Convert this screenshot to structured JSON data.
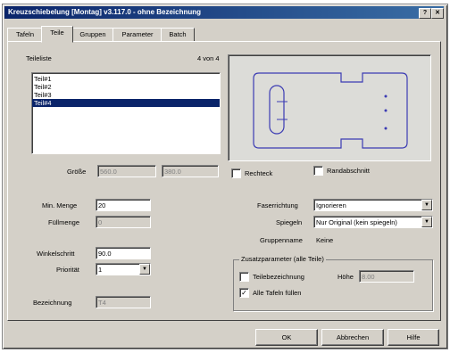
{
  "window": {
    "title": "Kreuzschiebelung [Montag] v3.117.0 - ohne Bezeichnung"
  },
  "tabs": [
    {
      "label": "Tafeln"
    },
    {
      "label": "Teile"
    },
    {
      "label": "Gruppen"
    },
    {
      "label": "Parameter"
    },
    {
      "label": "Batch"
    }
  ],
  "parts": {
    "header": "Teileliste",
    "count": "4 von 4",
    "items": [
      "Teil#1",
      "Teil#2",
      "Teil#3",
      "Teil#4"
    ],
    "selected_index": 3
  },
  "size": {
    "label": "Größe",
    "width": "560.0",
    "height": "380.0"
  },
  "checkboxes": {
    "rechteck": {
      "label": "Rechteck",
      "checked": false
    },
    "randabschnitt": {
      "label": "Randabschnitt",
      "checked": false
    }
  },
  "fields": {
    "min_menge": {
      "label": "Min. Menge",
      "value": "20"
    },
    "fuellmenge": {
      "label": "Füllmenge",
      "value": "0"
    },
    "winkelschritt": {
      "label": "Winkelschritt",
      "value": "90.0"
    },
    "prioritaet": {
      "label": "Priorität",
      "value": "1"
    },
    "bezeichnung": {
      "label": "Bezeichnung",
      "value": "T4"
    }
  },
  "right": {
    "faserrichtung_label": "Faserrichtung",
    "faserrichtung_value": "Ignorieren",
    "spiegeln_label": "Spiegeln",
    "spiegeln_value": "Nur Original (kein spiegeln)",
    "gruppenname_label": "Gruppenname",
    "gruppenname_value": "Keine"
  },
  "zusatz": {
    "title": "Zusatzparameter (alle Teile)",
    "teilebezeichnung": {
      "label": "Teilebezeichnung",
      "checked": false
    },
    "hoehe_label": "Höhe",
    "hoehe_value": "8.00",
    "alle_tafeln": {
      "label": "Alle Tafeln füllen",
      "checked": true
    }
  },
  "buttons": {
    "ok": "OK",
    "abbrechen": "Abbrechen",
    "hilfe": "Hilfe"
  },
  "colors": {
    "titlebar": "#0a246a",
    "selection": "#0a246a",
    "preview_stroke": "#3b3bb3"
  }
}
